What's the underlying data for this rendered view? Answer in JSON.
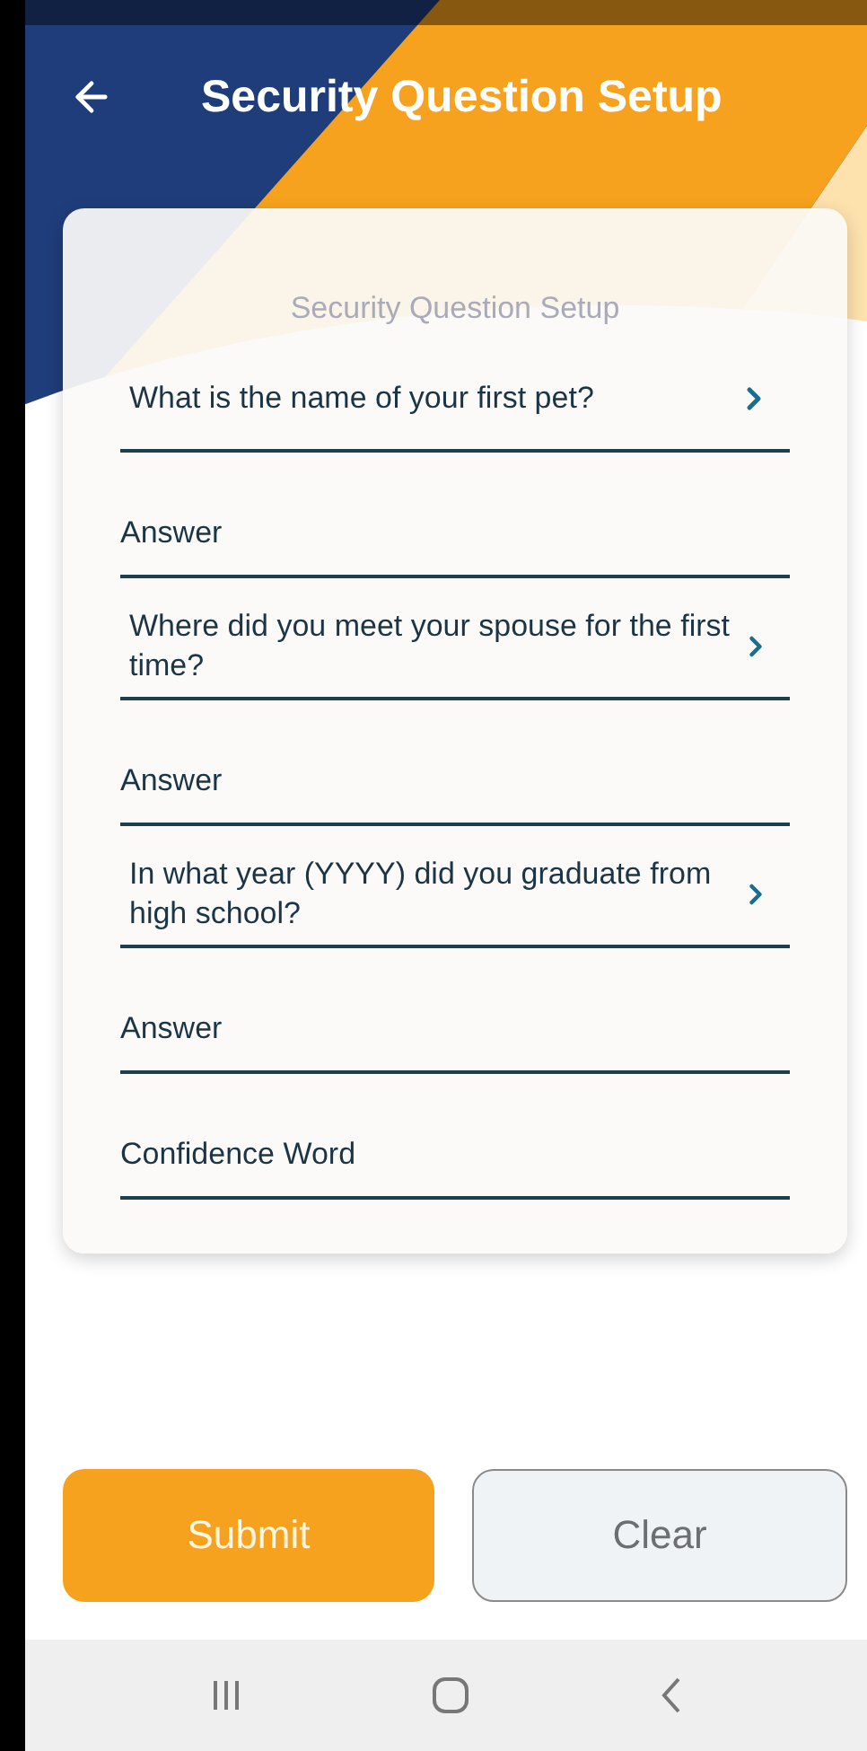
{
  "header": {
    "title": "Security Question Setup"
  },
  "card": {
    "title": "Security Question Setup",
    "fields": [
      {
        "kind": "select",
        "value": "What is the name of your first pet?"
      },
      {
        "kind": "input",
        "placeholder": "Answer"
      },
      {
        "kind": "select",
        "value": "Where did you meet your spouse for the first time?"
      },
      {
        "kind": "input",
        "placeholder": "Answer"
      },
      {
        "kind": "select",
        "value": "In what year (YYYY) did you graduate from high school?"
      },
      {
        "kind": "input",
        "placeholder": "Answer"
      },
      {
        "kind": "input",
        "placeholder": "Confidence Word"
      }
    ]
  },
  "buttons": [
    {
      "label": "Submit",
      "kind": "primary"
    },
    {
      "label": "Clear",
      "kind": "secondary"
    }
  ]
}
